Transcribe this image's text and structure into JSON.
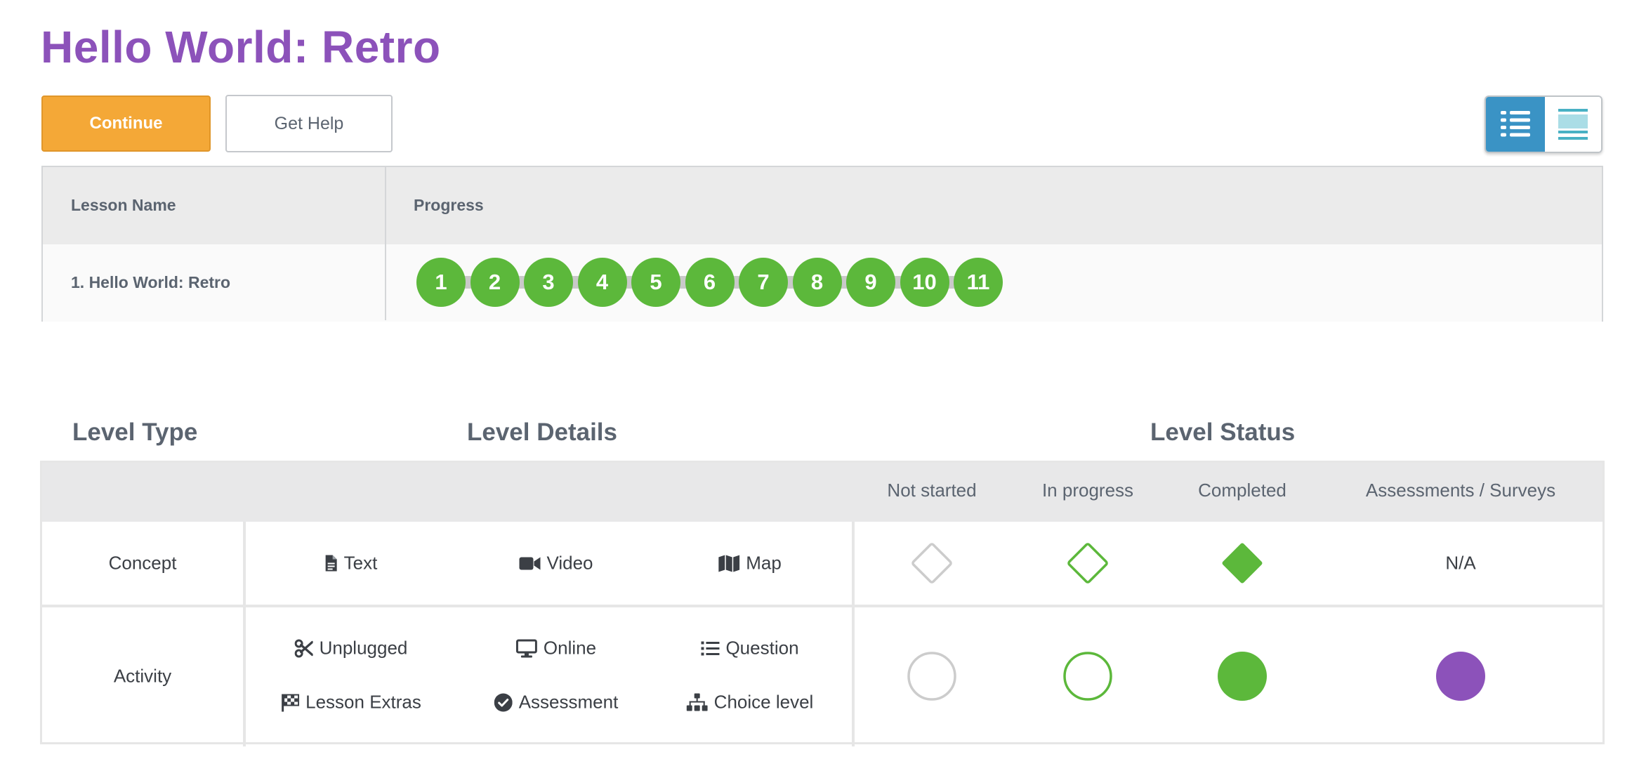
{
  "page": {
    "title": "Hello World: Retro"
  },
  "actions": {
    "continue_label": "Continue",
    "help_label": "Get Help"
  },
  "view_toggle": {
    "detail_icon": "detail-view-icon",
    "summary_icon": "summary-view-icon",
    "selected": "detail"
  },
  "lessons_table": {
    "headers": {
      "name": "Lesson Name",
      "progress": "Progress"
    },
    "rows": [
      {
        "name": "1. Hello World: Retro",
        "levels": [
          "1",
          "2",
          "3",
          "4",
          "5",
          "6",
          "7",
          "8",
          "9",
          "10",
          "11"
        ],
        "level_status": "completed"
      }
    ]
  },
  "key": {
    "headings": {
      "level_type": "Level Type",
      "level_details": "Level Details",
      "level_status": "Level Status"
    },
    "status_columns": [
      "Not started",
      "In progress",
      "Completed",
      "Assessments / Surveys"
    ],
    "rows": [
      {
        "type": "Concept",
        "details": [
          {
            "label": "Text",
            "icon": "file-text-icon"
          },
          {
            "label": "Video",
            "icon": "video-camera-icon"
          },
          {
            "label": "Map",
            "icon": "map-icon"
          }
        ],
        "assessment": "N/A"
      },
      {
        "type": "Activity",
        "details": [
          {
            "label": "Unplugged",
            "icon": "scissors-icon"
          },
          {
            "label": "Online",
            "icon": "desktop-icon"
          },
          {
            "label": "Question",
            "icon": "list-icon"
          },
          {
            "label": "Lesson Extras",
            "icon": "checkered-flag-icon"
          },
          {
            "label": "Assessment",
            "icon": "check-circle-icon"
          },
          {
            "label": "Choice level",
            "icon": "sitemap-icon"
          }
        ]
      }
    ],
    "colors": {
      "completed": "#5cb83b",
      "not_started_border": "#cccccc",
      "assessment": "#8c52ba"
    }
  }
}
